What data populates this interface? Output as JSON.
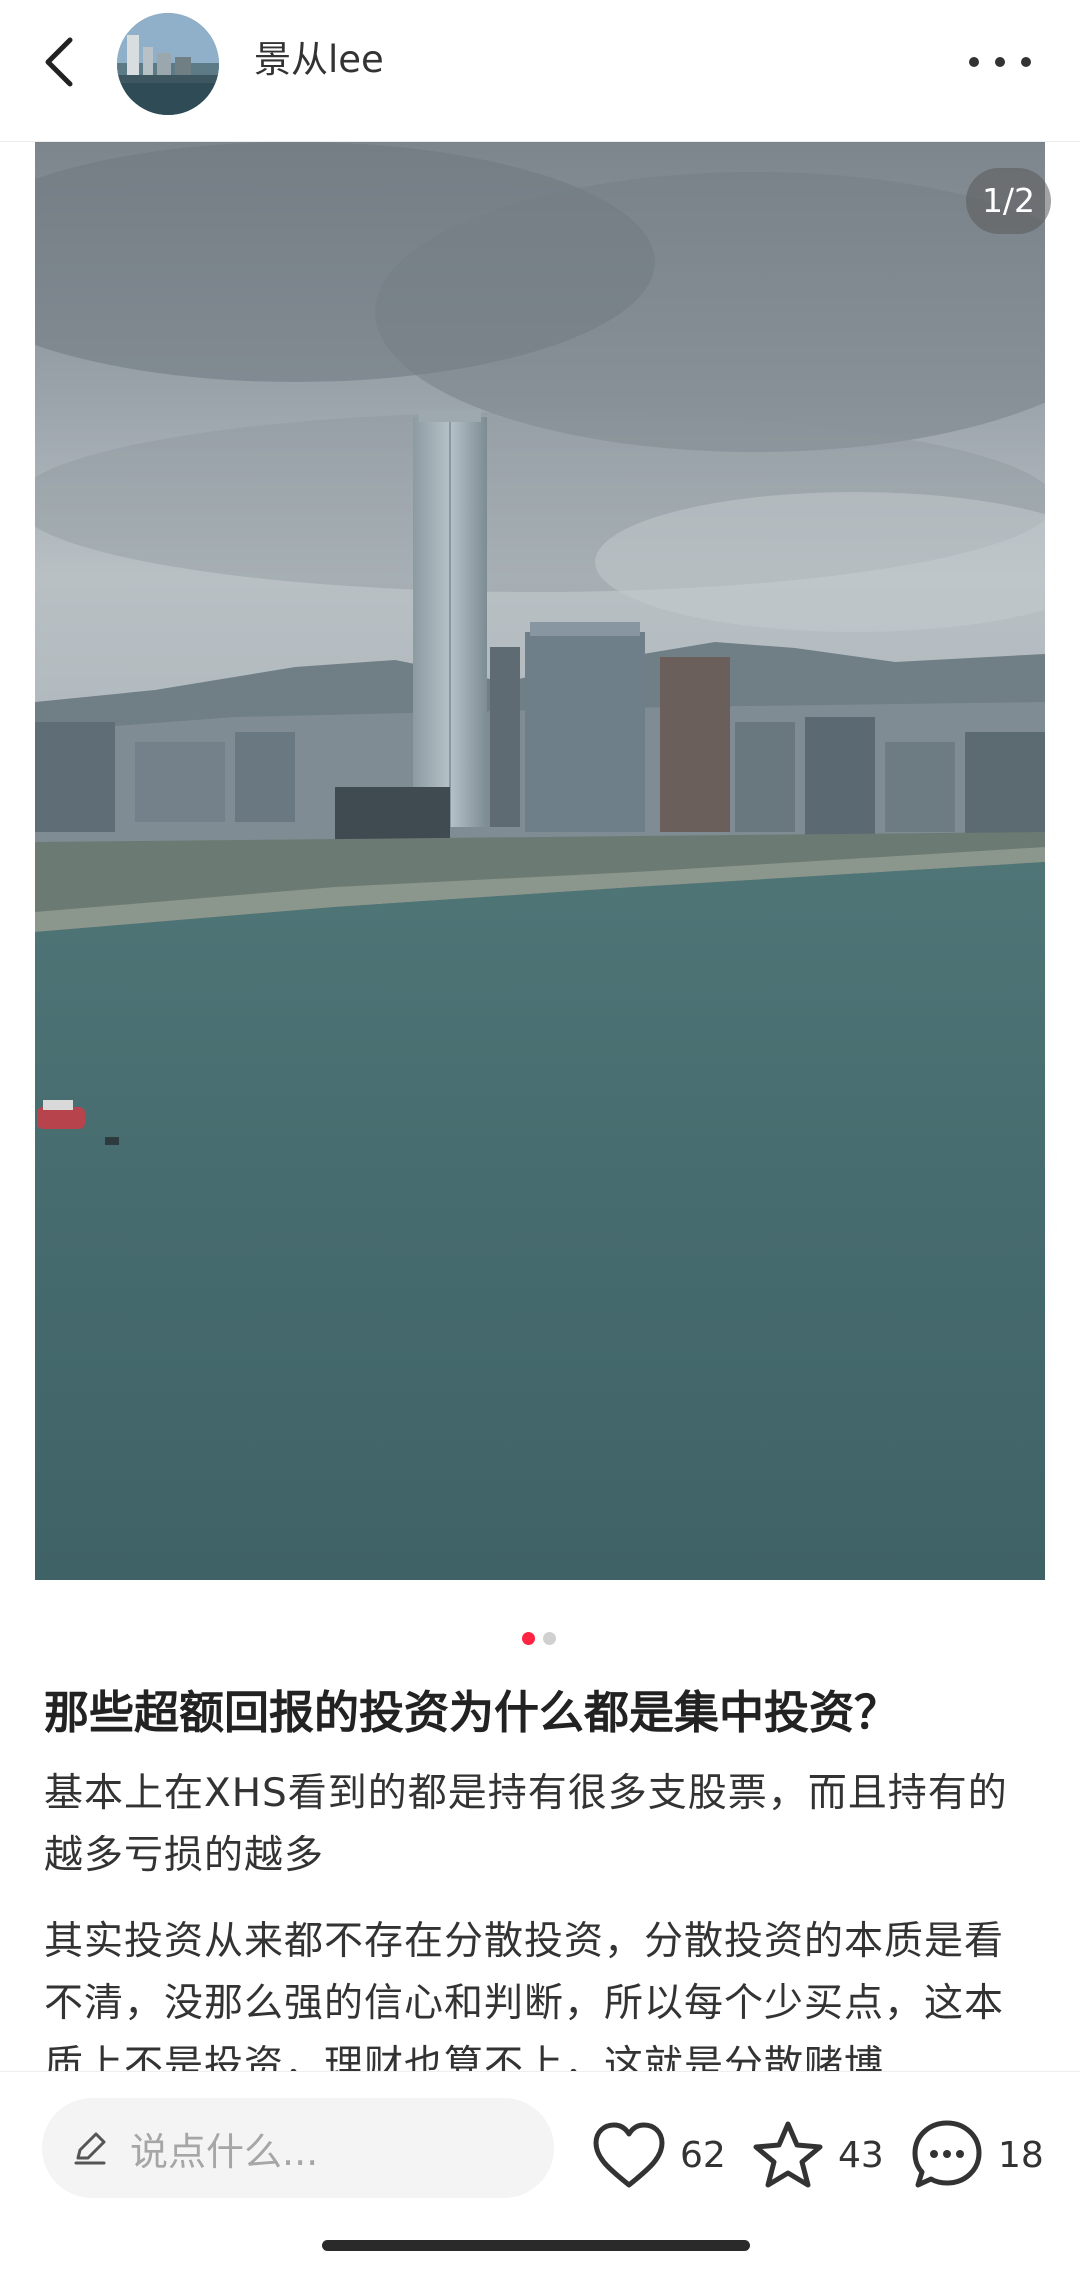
{
  "header": {
    "author_name": "景从lee",
    "back_icon": "chevron-left-icon",
    "more_icon": "more-horizontal-icon"
  },
  "media": {
    "page_counter": "1/2",
    "current_page": 1,
    "total_pages": 2
  },
  "post": {
    "title": "那些超额回报的投资为什么都是集中投资？",
    "paragraphs": [
      "基本上在XHS看到的都是持有很多支股票，而且持有的越多亏损的越多",
      "其实投资从来都不存在分散投资，分散投资的本质是看不清，没那么强的信心和判断，所以每个少买点，这本质上不是投资，理财也算不上，这就是分散赌博"
    ]
  },
  "bottom_bar": {
    "comment_placeholder": "说点什么...",
    "like_count": "62",
    "collect_count": "43",
    "comment_count": "18"
  },
  "colors": {
    "accent": "#ff2442",
    "dot_inactive": "#d0d0d0",
    "input_bg": "#f4f4f4"
  }
}
